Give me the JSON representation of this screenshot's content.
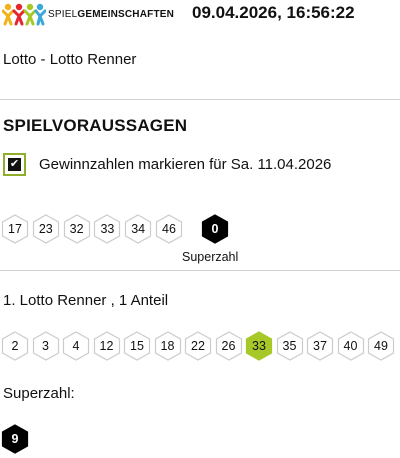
{
  "header": {
    "brand_prefix": "SPIEL",
    "brand_bold": "GEMEINSCHAFTEN",
    "datetime": "09.04.2026, 16:56:22",
    "logo_icon": "people-logo-icon"
  },
  "game": {
    "title": "Lotto - Lotto Renner"
  },
  "predictions": {
    "section_title": "SPIELVORAUSSAGEN",
    "checkbox_checked": true,
    "checkbox_label": "Gewinnzahlen markieren für Sa. 11.04.2026",
    "numbers": [
      "17",
      "23",
      "32",
      "33",
      "34",
      "46"
    ],
    "superzahl": "0",
    "superzahl_caption": "Superzahl"
  },
  "ticket": {
    "title": "1. Lotto Renner , 1 Anteil",
    "numbers": [
      "2",
      "3",
      "4",
      "12",
      "15",
      "18",
      "22",
      "26",
      "33",
      "35",
      "37",
      "40",
      "49"
    ],
    "highlighted": [
      "33"
    ],
    "superzahl_label": "Superzahl:",
    "superzahl": "9"
  },
  "colors": {
    "accent_green": "#a7c928",
    "checkbox_border": "#8fae2a",
    "hex_border": "#cccccc",
    "dark_ball": "#000000",
    "divider": "#d3d3d3"
  }
}
